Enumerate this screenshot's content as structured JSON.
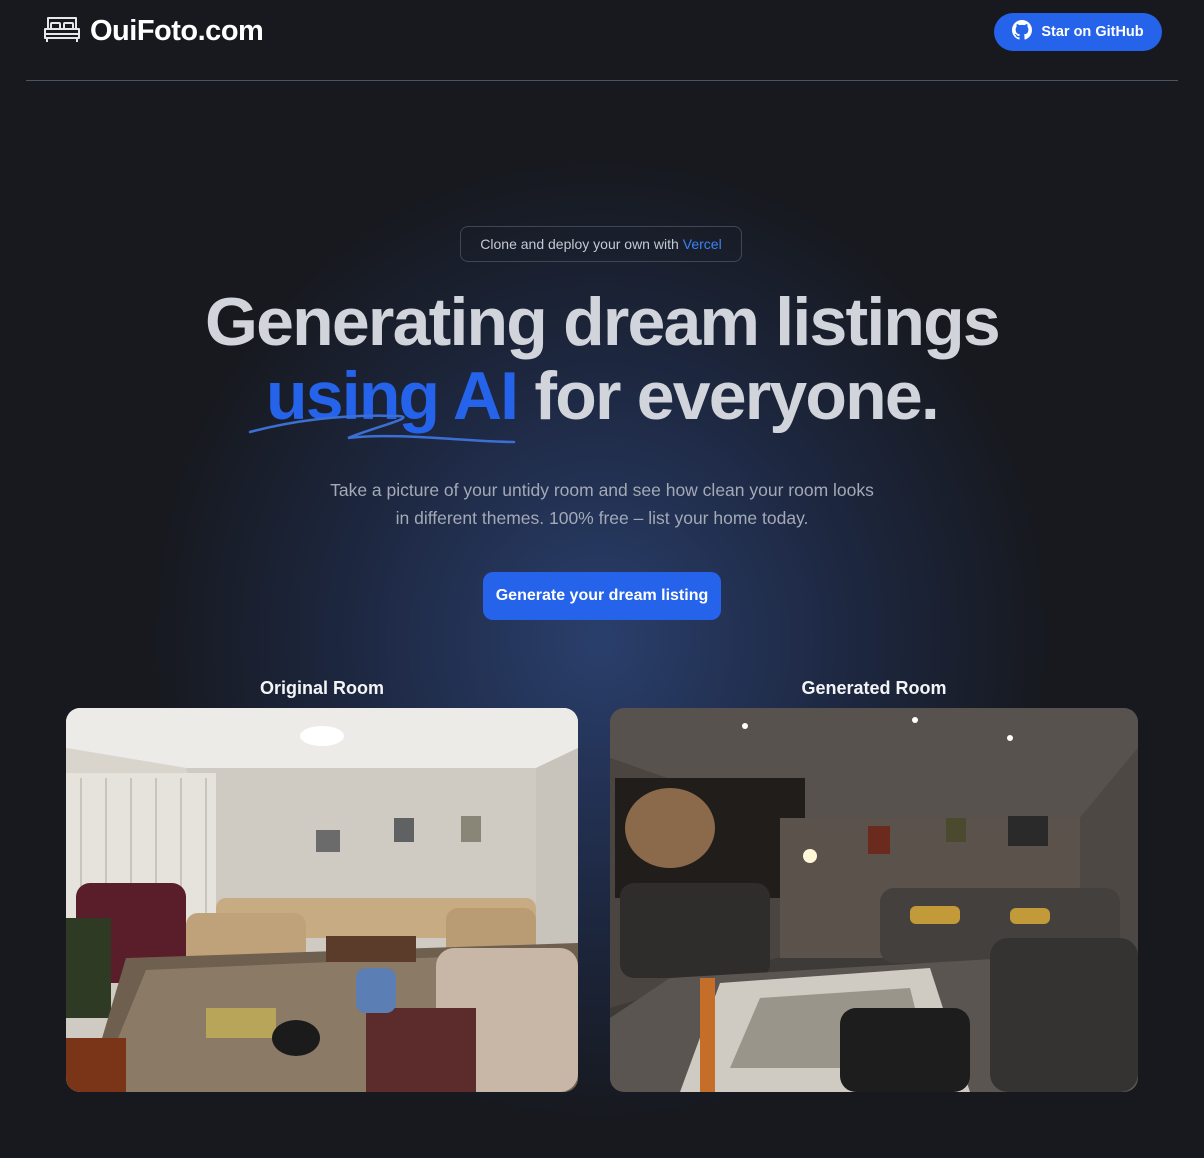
{
  "header": {
    "logo_text": "OuiFoto.com",
    "logo_icon": "bed-icon",
    "github_button_label": "Star on GitHub",
    "github_icon": "github-icon"
  },
  "hero": {
    "pill_text": "Clone and deploy your own with",
    "pill_link": "Vercel",
    "title_line1": "Generating dream listings",
    "title_accent": "using AI",
    "title_rest": " for everyone.",
    "subtitle_line1": "Take a picture of your untidy room and see how clean your room looks",
    "subtitle_line2": "in different themes. 100% free – list your home today.",
    "cta_label": "Generate your dream listing"
  },
  "comparison": {
    "original_label": "Original Room",
    "generated_label": "Generated Room"
  },
  "colors": {
    "accent": "#2563eb",
    "background": "#17191f",
    "text": "#d1d5db"
  }
}
